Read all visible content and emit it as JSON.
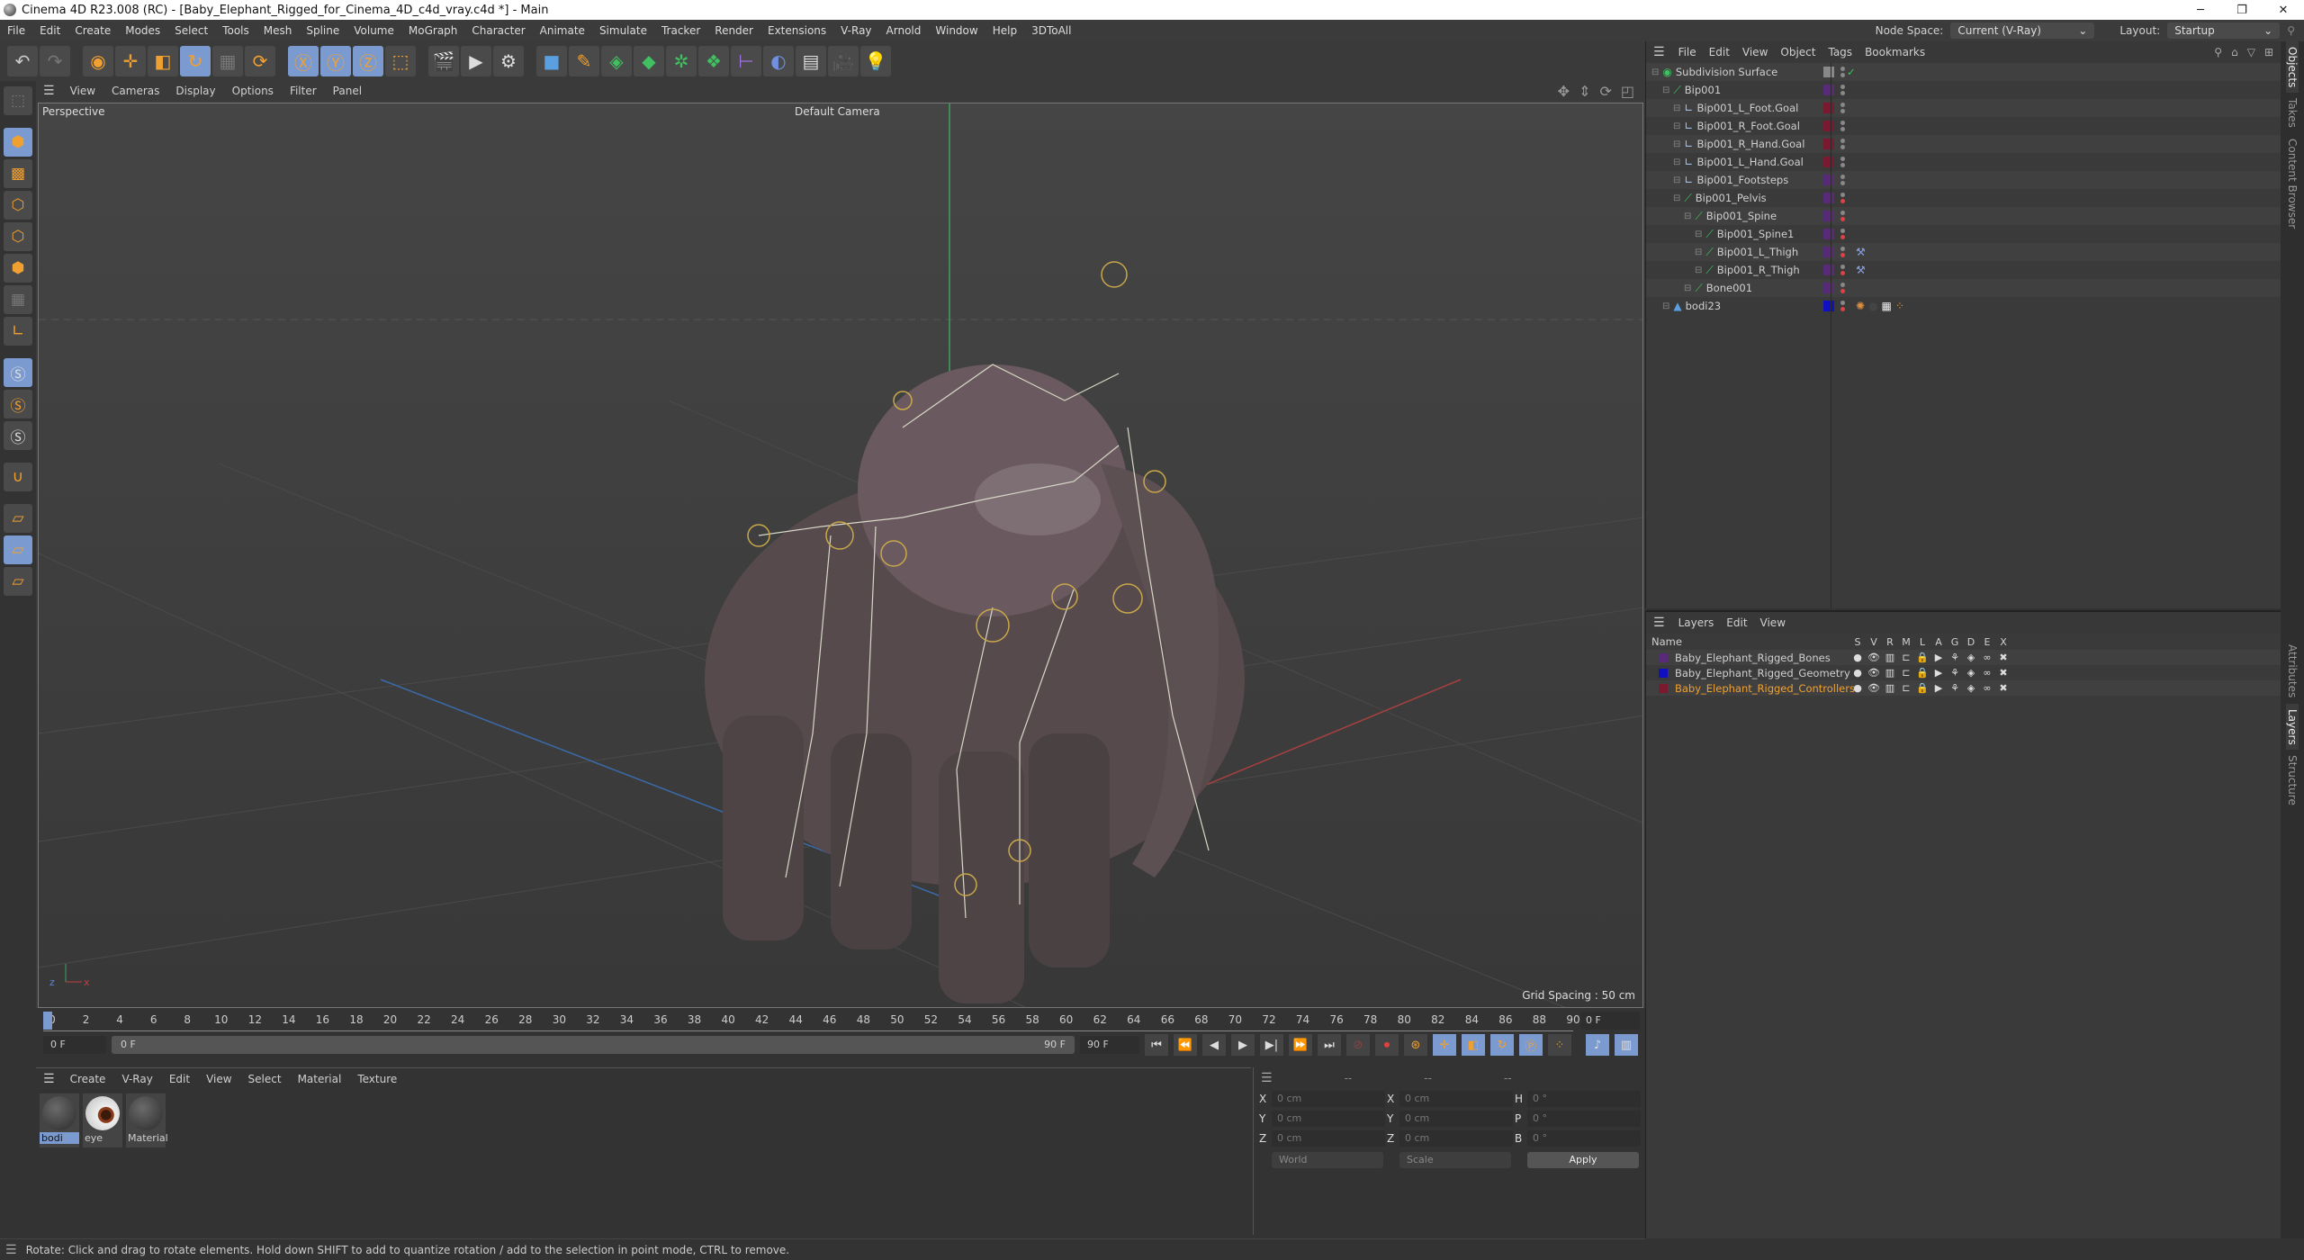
{
  "titlebar": {
    "title": "Cinema 4D R23.008 (RC) - [Baby_Elephant_Rigged_for_Cinema_4D_c4d_vray.c4d *] - Main",
    "minimize": "─",
    "maximize": "❐",
    "close": "✕"
  },
  "menubar": {
    "items": [
      "File",
      "Edit",
      "Create",
      "Modes",
      "Select",
      "Tools",
      "Mesh",
      "Spline",
      "Volume",
      "MoGraph",
      "Character",
      "Animate",
      "Simulate",
      "Tracker",
      "Render",
      "Extensions",
      "V-Ray",
      "Arnold",
      "Window",
      "Help",
      "3DToAll"
    ],
    "node_space_label": "Node Space:",
    "node_space_value": "Current (V-Ray)",
    "layout_label": "Layout:",
    "layout_value": "Startup"
  },
  "viewport": {
    "menu": [
      "View",
      "Cameras",
      "Display",
      "Options",
      "Filter",
      "Panel"
    ],
    "view_name": "Perspective",
    "camera": "Default Camera",
    "grid_spacing": "Grid Spacing : 50 cm"
  },
  "timeline": {
    "ticks": [
      "0",
      "2",
      "4",
      "6",
      "8",
      "10",
      "12",
      "14",
      "16",
      "18",
      "20",
      "22",
      "24",
      "26",
      "28",
      "30",
      "32",
      "34",
      "36",
      "38",
      "40",
      "42",
      "44",
      "46",
      "48",
      "50",
      "52",
      "54",
      "56",
      "58",
      "60",
      "62",
      "64",
      "66",
      "68",
      "70",
      "72",
      "74",
      "76",
      "78",
      "80",
      "82",
      "84",
      "86",
      "88",
      "90"
    ],
    "current_frame_right": "0 F",
    "start_field": "0 F",
    "range_start": "0 F",
    "range_end": "90 F",
    "end_field": "90 F"
  },
  "materials": {
    "menu": [
      "Create",
      "V-Ray",
      "Edit",
      "View",
      "Select",
      "Material",
      "Texture"
    ],
    "items": [
      {
        "name": "bodi",
        "selected": true
      },
      {
        "name": "eye",
        "selected": false
      },
      {
        "name": "Material",
        "selected": false
      }
    ]
  },
  "coordinates": {
    "headers": [
      "--",
      "--",
      "--"
    ],
    "rows": [
      {
        "a1": "X",
        "v1": "0 cm",
        "a2": "X",
        "v2": "0 cm",
        "a3": "H",
        "v3": "0 °"
      },
      {
        "a1": "Y",
        "v1": "0 cm",
        "a2": "Y",
        "v2": "0 cm",
        "a3": "P",
        "v3": "0 °"
      },
      {
        "a1": "Z",
        "v1": "0 cm",
        "a2": "Z",
        "v2": "0 cm",
        "a3": "B",
        "v3": "0 °"
      }
    ],
    "space": "World",
    "mode": "Scale",
    "apply": "Apply"
  },
  "status": "Rotate: Click and drag to rotate elements. Hold down SHIFT to add to quantize rotation / add to the selection in point mode, CTRL to remove.",
  "objects": {
    "menu": [
      "File",
      "Edit",
      "View",
      "Object",
      "Tags",
      "Bookmarks"
    ],
    "items": [
      {
        "name": "Subdivision Surface",
        "depth": 0,
        "color": "#888888",
        "icon": "subdivision"
      },
      {
        "name": "Bip001",
        "depth": 1,
        "color": "#5a2a7a",
        "icon": "bone"
      },
      {
        "name": "Bip001_L_Foot.Goal",
        "depth": 2,
        "color": "#7a1a30",
        "icon": "null"
      },
      {
        "name": "Bip001_R_Foot.Goal",
        "depth": 2,
        "color": "#7a1a30",
        "icon": "null"
      },
      {
        "name": "Bip001_R_Hand.Goal",
        "depth": 2,
        "color": "#7a1a30",
        "icon": "null"
      },
      {
        "name": "Bip001_L_Hand.Goal",
        "depth": 2,
        "color": "#7a1a30",
        "icon": "null"
      },
      {
        "name": "Bip001_Footsteps",
        "depth": 2,
        "color": "#5a2a7a",
        "icon": "null"
      },
      {
        "name": "Bip001_Pelvis",
        "depth": 2,
        "color": "#5a2a7a",
        "icon": "bone"
      },
      {
        "name": "Bip001_Spine",
        "depth": 3,
        "color": "#5a2a7a",
        "icon": "bone"
      },
      {
        "name": "Bip001_Spine1",
        "depth": 4,
        "color": "#5a2a7a",
        "icon": "bone"
      },
      {
        "name": "Bip001_L_Thigh",
        "depth": 4,
        "color": "#5a2a7a",
        "icon": "bone",
        "tag": "ik-tag"
      },
      {
        "name": "Bip001_R_Thigh",
        "depth": 4,
        "color": "#5a2a7a",
        "icon": "bone",
        "tag": "ik-tag"
      },
      {
        "name": "Bone001",
        "depth": 3,
        "color": "#5a2a7a",
        "icon": "bone"
      },
      {
        "name": "bodi23",
        "depth": 1,
        "color": "#1010c0",
        "icon": "polygon",
        "tag": "material-tags"
      }
    ]
  },
  "layers": {
    "menu": [
      "Layers",
      "Edit",
      "View"
    ],
    "name_header": "Name",
    "columns": [
      "S",
      "V",
      "R",
      "M",
      "L",
      "A",
      "G",
      "D",
      "E",
      "X"
    ],
    "items": [
      {
        "name": "Baby_Elephant_Rigged_Bones",
        "color": "#5a2a7a",
        "highlight": false
      },
      {
        "name": "Baby_Elephant_Rigged_Geometry",
        "color": "#1010c0",
        "highlight": false
      },
      {
        "name": "Baby_Elephant_Rigged_Controllers",
        "color": "#7a1a30",
        "highlight": true
      }
    ],
    "highlight_color": "#f0a030"
  },
  "side_tabs": {
    "top": [
      "Objects",
      "Takes",
      "Content Browser"
    ],
    "bottom": [
      "Attributes",
      "Layers",
      "Structure"
    ]
  }
}
